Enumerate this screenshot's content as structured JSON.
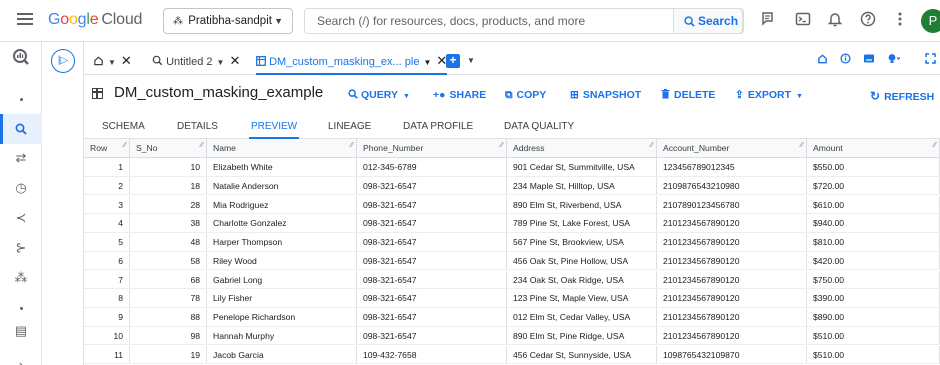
{
  "topbar": {
    "logo_word": "Google",
    "logo_product": "Cloud",
    "project_name": "Pratibha-sandpit",
    "search_placeholder": "Search (/) for resources, docs, products, and more",
    "search_button": "Search",
    "avatar_letter": "P"
  },
  "tabs": [
    {
      "label": "",
      "kind": "home"
    },
    {
      "label": "Untitled 2",
      "kind": "query"
    },
    {
      "label": "DM_custom_masking_ex... ple",
      "kind": "table"
    }
  ],
  "table": {
    "name": "DM_custom_masking_example",
    "actions": {
      "query": "QUERY",
      "share": "SHARE",
      "copy": "COPY",
      "snapshot": "SNAPSHOT",
      "delete": "DELETE",
      "export": "EXPORT",
      "refresh": "REFRESH"
    }
  },
  "subtabs": [
    "SCHEMA",
    "DETAILS",
    "PREVIEW",
    "LINEAGE",
    "DATA PROFILE",
    "DATA QUALITY"
  ],
  "active_subtab": "PREVIEW",
  "grid": {
    "columns": [
      "Row",
      "S_No",
      "Name",
      "Phone_Number",
      "Address",
      "Account_Number",
      "Amount"
    ],
    "rows": [
      [
        "1",
        "10",
        "Elizabeth White",
        "012-345-6789",
        "901 Cedar St, Summitville, USA",
        "123456789012345",
        "$550.00"
      ],
      [
        "2",
        "18",
        "Natalie Anderson",
        "098-321-6547",
        "234 Maple St, Hilltop, USA",
        "2109876543210980",
        "$720.00"
      ],
      [
        "3",
        "28",
        "Mia Rodriguez",
        "098-321-6547",
        "890 Elm St, Riverbend, USA",
        "2107890123456780",
        "$610.00"
      ],
      [
        "4",
        "38",
        "Charlotte Gonzalez",
        "098-321-6547",
        "789 Pine St, Lake Forest, USA",
        "2101234567890120",
        "$940.00"
      ],
      [
        "5",
        "48",
        "Harper Thompson",
        "098-321-6547",
        "567 Pine St, Brookview, USA",
        "2101234567890120",
        "$810.00"
      ],
      [
        "6",
        "58",
        "Riley Wood",
        "098-321-6547",
        "456 Oak St, Pine Hollow, USA",
        "2101234567890120",
        "$420.00"
      ],
      [
        "7",
        "68",
        "Gabriel Long",
        "098-321-6547",
        "234 Oak St, Oak Ridge, USA",
        "2101234567890120",
        "$750.00"
      ],
      [
        "8",
        "78",
        "Lily Fisher",
        "098-321-6547",
        "123 Pine St, Maple View, USA",
        "2101234567890120",
        "$390.00"
      ],
      [
        "9",
        "88",
        "Penelope Richardson",
        "098-321-6547",
        "012 Elm St, Cedar Valley, USA",
        "2101234567890120",
        "$890.00"
      ],
      [
        "10",
        "98",
        "Hannah Murphy",
        "098-321-6547",
        "890 Elm St, Pine Ridge, USA",
        "2101234567890120",
        "$510.00"
      ],
      [
        "11",
        "19",
        "Jacob Garcia",
        "109-432-7658",
        "456 Cedar St, Sunnyside, USA",
        "1098765432109870",
        "$510.00"
      ]
    ]
  },
  "colors": {
    "accent": "#1a73e8",
    "text": "#202124",
    "muted": "#5f6368",
    "avatar": "#1e7e34"
  }
}
